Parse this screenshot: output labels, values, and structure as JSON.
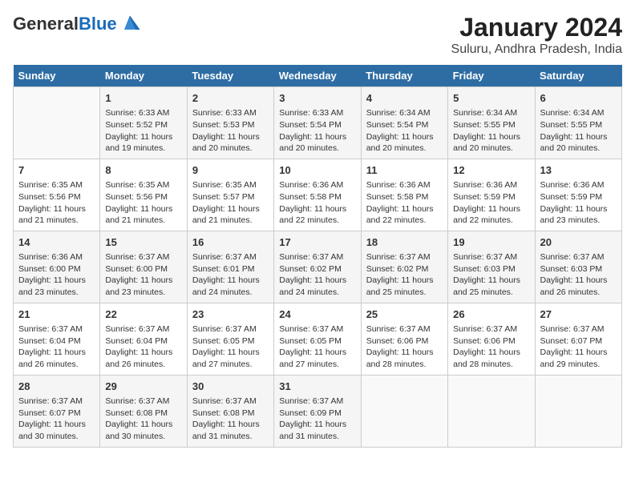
{
  "header": {
    "logo_general": "General",
    "logo_blue": "Blue",
    "title": "January 2024",
    "subtitle": "Suluru, Andhra Pradesh, India"
  },
  "calendar": {
    "days_of_week": [
      "Sunday",
      "Monday",
      "Tuesday",
      "Wednesday",
      "Thursday",
      "Friday",
      "Saturday"
    ],
    "weeks": [
      [
        {
          "day": "",
          "info": ""
        },
        {
          "day": "1",
          "info": "Sunrise: 6:33 AM\nSunset: 5:52 PM\nDaylight: 11 hours\nand 19 minutes."
        },
        {
          "day": "2",
          "info": "Sunrise: 6:33 AM\nSunset: 5:53 PM\nDaylight: 11 hours\nand 20 minutes."
        },
        {
          "day": "3",
          "info": "Sunrise: 6:33 AM\nSunset: 5:54 PM\nDaylight: 11 hours\nand 20 minutes."
        },
        {
          "day": "4",
          "info": "Sunrise: 6:34 AM\nSunset: 5:54 PM\nDaylight: 11 hours\nand 20 minutes."
        },
        {
          "day": "5",
          "info": "Sunrise: 6:34 AM\nSunset: 5:55 PM\nDaylight: 11 hours\nand 20 minutes."
        },
        {
          "day": "6",
          "info": "Sunrise: 6:34 AM\nSunset: 5:55 PM\nDaylight: 11 hours\nand 20 minutes."
        }
      ],
      [
        {
          "day": "7",
          "info": "Sunrise: 6:35 AM\nSunset: 5:56 PM\nDaylight: 11 hours\nand 21 minutes."
        },
        {
          "day": "8",
          "info": "Sunrise: 6:35 AM\nSunset: 5:56 PM\nDaylight: 11 hours\nand 21 minutes."
        },
        {
          "day": "9",
          "info": "Sunrise: 6:35 AM\nSunset: 5:57 PM\nDaylight: 11 hours\nand 21 minutes."
        },
        {
          "day": "10",
          "info": "Sunrise: 6:36 AM\nSunset: 5:58 PM\nDaylight: 11 hours\nand 22 minutes."
        },
        {
          "day": "11",
          "info": "Sunrise: 6:36 AM\nSunset: 5:58 PM\nDaylight: 11 hours\nand 22 minutes."
        },
        {
          "day": "12",
          "info": "Sunrise: 6:36 AM\nSunset: 5:59 PM\nDaylight: 11 hours\nand 22 minutes."
        },
        {
          "day": "13",
          "info": "Sunrise: 6:36 AM\nSunset: 5:59 PM\nDaylight: 11 hours\nand 23 minutes."
        }
      ],
      [
        {
          "day": "14",
          "info": "Sunrise: 6:36 AM\nSunset: 6:00 PM\nDaylight: 11 hours\nand 23 minutes."
        },
        {
          "day": "15",
          "info": "Sunrise: 6:37 AM\nSunset: 6:00 PM\nDaylight: 11 hours\nand 23 minutes."
        },
        {
          "day": "16",
          "info": "Sunrise: 6:37 AM\nSunset: 6:01 PM\nDaylight: 11 hours\nand 24 minutes."
        },
        {
          "day": "17",
          "info": "Sunrise: 6:37 AM\nSunset: 6:02 PM\nDaylight: 11 hours\nand 24 minutes."
        },
        {
          "day": "18",
          "info": "Sunrise: 6:37 AM\nSunset: 6:02 PM\nDaylight: 11 hours\nand 25 minutes."
        },
        {
          "day": "19",
          "info": "Sunrise: 6:37 AM\nSunset: 6:03 PM\nDaylight: 11 hours\nand 25 minutes."
        },
        {
          "day": "20",
          "info": "Sunrise: 6:37 AM\nSunset: 6:03 PM\nDaylight: 11 hours\nand 26 minutes."
        }
      ],
      [
        {
          "day": "21",
          "info": "Sunrise: 6:37 AM\nSunset: 6:04 PM\nDaylight: 11 hours\nand 26 minutes."
        },
        {
          "day": "22",
          "info": "Sunrise: 6:37 AM\nSunset: 6:04 PM\nDaylight: 11 hours\nand 26 minutes."
        },
        {
          "day": "23",
          "info": "Sunrise: 6:37 AM\nSunset: 6:05 PM\nDaylight: 11 hours\nand 27 minutes."
        },
        {
          "day": "24",
          "info": "Sunrise: 6:37 AM\nSunset: 6:05 PM\nDaylight: 11 hours\nand 27 minutes."
        },
        {
          "day": "25",
          "info": "Sunrise: 6:37 AM\nSunset: 6:06 PM\nDaylight: 11 hours\nand 28 minutes."
        },
        {
          "day": "26",
          "info": "Sunrise: 6:37 AM\nSunset: 6:06 PM\nDaylight: 11 hours\nand 28 minutes."
        },
        {
          "day": "27",
          "info": "Sunrise: 6:37 AM\nSunset: 6:07 PM\nDaylight: 11 hours\nand 29 minutes."
        }
      ],
      [
        {
          "day": "28",
          "info": "Sunrise: 6:37 AM\nSunset: 6:07 PM\nDaylight: 11 hours\nand 30 minutes."
        },
        {
          "day": "29",
          "info": "Sunrise: 6:37 AM\nSunset: 6:08 PM\nDaylight: 11 hours\nand 30 minutes."
        },
        {
          "day": "30",
          "info": "Sunrise: 6:37 AM\nSunset: 6:08 PM\nDaylight: 11 hours\nand 31 minutes."
        },
        {
          "day": "31",
          "info": "Sunrise: 6:37 AM\nSunset: 6:09 PM\nDaylight: 11 hours\nand 31 minutes."
        },
        {
          "day": "",
          "info": ""
        },
        {
          "day": "",
          "info": ""
        },
        {
          "day": "",
          "info": ""
        }
      ]
    ]
  }
}
